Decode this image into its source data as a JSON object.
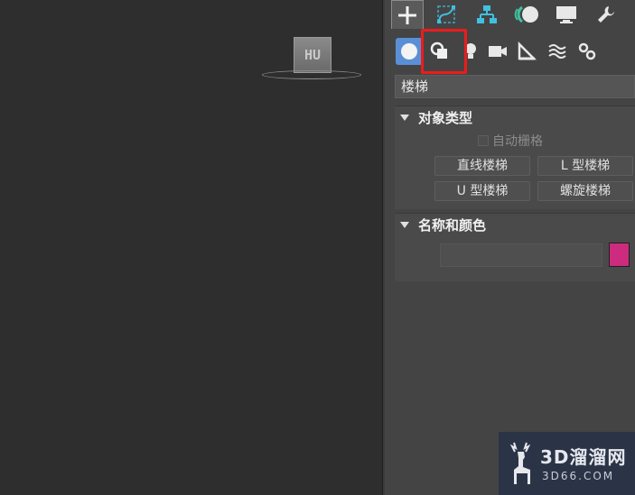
{
  "viewport": {
    "viewcube_label": "HU"
  },
  "command_panel": {
    "tabs": [
      {
        "name": "create",
        "icon": "plus-icon",
        "active": true
      },
      {
        "name": "modify",
        "icon": "modify-curve-icon"
      },
      {
        "name": "hierarchy",
        "icon": "hierarchy-icon"
      },
      {
        "name": "motion",
        "icon": "motion-icon"
      },
      {
        "name": "display",
        "icon": "monitor-icon"
      },
      {
        "name": "utilities",
        "icon": "wrench-icon"
      }
    ],
    "subtabs": [
      {
        "name": "geometry",
        "icon": "sphere-icon",
        "active": true
      },
      {
        "name": "shapes",
        "icon": "shapes-icon",
        "highlighted": true
      },
      {
        "name": "lights",
        "icon": "bulb-icon"
      },
      {
        "name": "cameras",
        "icon": "camera-icon"
      },
      {
        "name": "helpers",
        "icon": "ruler-icon"
      },
      {
        "name": "space-warps",
        "icon": "waves-icon"
      },
      {
        "name": "systems",
        "icon": "gears-icon"
      }
    ],
    "category": "楼梯",
    "object_type": {
      "title": "对象类型",
      "autogrid_label": "自动栅格",
      "buttons": [
        "直线楼梯",
        "L 型楼梯",
        "U 型楼梯",
        "螺旋楼梯"
      ]
    },
    "name_color": {
      "title": "名称和颜色",
      "name_value": "",
      "swatch_color": "#cc2b7e"
    }
  },
  "watermark": {
    "name": "3D溜溜网",
    "url": "3D66.COM"
  },
  "colors": {
    "highlight": "#ee1b1b",
    "active_subtab": "#5a8fd6"
  }
}
